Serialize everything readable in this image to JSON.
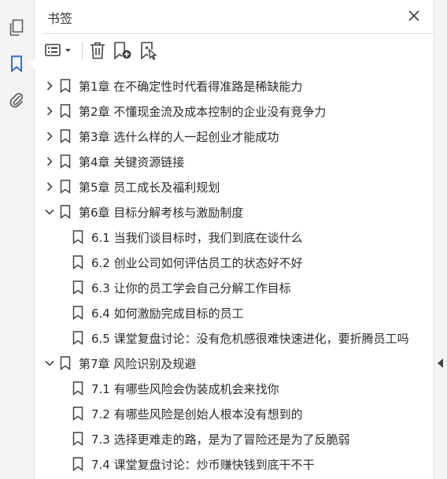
{
  "panel": {
    "title": "书签"
  },
  "bookmarks": [
    {
      "label": "第1章  在不确定性时代看得准路是稀缺能力",
      "level": 0,
      "expanded": false
    },
    {
      "label": "第2章  不懂现金流及成本控制的企业没有竞争力",
      "level": 0,
      "expanded": false
    },
    {
      "label": "第3章  选什么样的人一起创业才能成功",
      "level": 0,
      "expanded": false
    },
    {
      "label": "第4章  关键资源链接",
      "level": 0,
      "expanded": false
    },
    {
      "label": "第5章  员工成长及福利规划",
      "level": 0,
      "expanded": false
    },
    {
      "label": "第6章  目标分解考核与激励制度",
      "level": 0,
      "expanded": true
    },
    {
      "label": "6.1  当我们谈目标时，我们到底在谈什么",
      "level": 1
    },
    {
      "label": "6.2  创业公司如何评估员工的状态好不好",
      "level": 1
    },
    {
      "label": "6.3  让你的员工学会自己分解工作目标",
      "level": 1
    },
    {
      "label": "6.4  如何激励完成目标的员工",
      "level": 1
    },
    {
      "label": "6.5  课堂复盘讨论：没有危机感很难快速进化，要折腾员工吗",
      "level": 1
    },
    {
      "label": "第7章  风险识别及规避",
      "level": 0,
      "expanded": true
    },
    {
      "label": "7.1  有哪些风险会伪装成机会来找你",
      "level": 1
    },
    {
      "label": "7.2  有哪些风险是创始人根本没有想到的",
      "level": 1
    },
    {
      "label": "7.3  选择更难走的路，是为了冒险还是为了反脆弱",
      "level": 1
    },
    {
      "label": "7.4  课堂复盘讨论：炒币赚快钱到底干不干",
      "level": 1
    }
  ]
}
